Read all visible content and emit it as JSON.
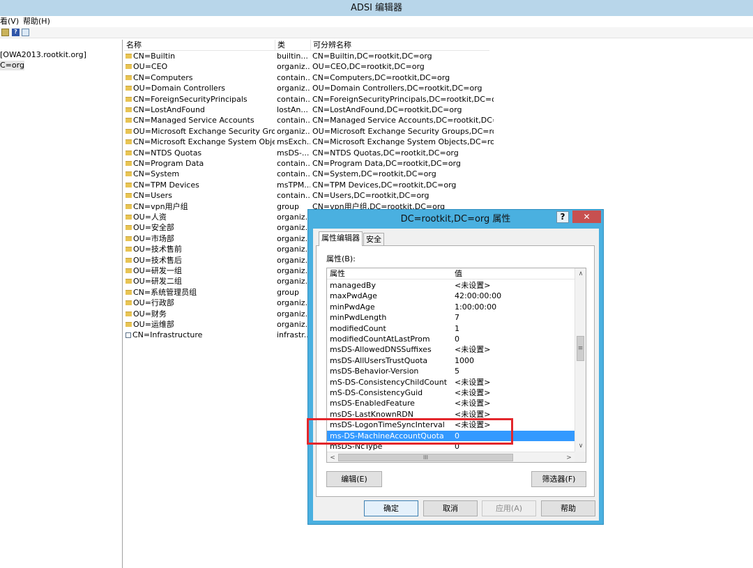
{
  "window": {
    "title": "ADSI 编辑器"
  },
  "menu": [
    "看(V)",
    "帮助(H)"
  ],
  "toolbar": {
    "icons": [
      "up-folder-icon",
      "help-icon",
      "show-hide-console-tree-icon"
    ]
  },
  "tree": [
    {
      "label": "[OWA2013.rootkit.org]",
      "selected": false
    },
    {
      "label": "C=org",
      "selected": true
    }
  ],
  "list": {
    "headers": {
      "name": "名称",
      "class": "类",
      "dn": "可分辨名称"
    },
    "rows": [
      {
        "icon": "folder",
        "name": "CN=Builtin",
        "class": "builtin...",
        "dn": "CN=Builtin,DC=rootkit,DC=org"
      },
      {
        "icon": "folder",
        "name": "OU=CEO",
        "class": "organiz...",
        "dn": "OU=CEO,DC=rootkit,DC=org"
      },
      {
        "icon": "folder",
        "name": "CN=Computers",
        "class": "contain...",
        "dn": "CN=Computers,DC=rootkit,DC=org"
      },
      {
        "icon": "folder",
        "name": "OU=Domain Controllers",
        "class": "organiz...",
        "dn": "OU=Domain Controllers,DC=rootkit,DC=org"
      },
      {
        "icon": "folder",
        "name": "CN=ForeignSecurityPrincipals",
        "class": "contain...",
        "dn": "CN=ForeignSecurityPrincipals,DC=rootkit,DC=org"
      },
      {
        "icon": "folder",
        "name": "CN=LostAndFound",
        "class": "lostAn...",
        "dn": "CN=LostAndFound,DC=rootkit,DC=org"
      },
      {
        "icon": "folder",
        "name": "CN=Managed Service Accounts",
        "class": "contain...",
        "dn": "CN=Managed Service Accounts,DC=rootkit,DC=..."
      },
      {
        "icon": "folder",
        "name": "OU=Microsoft Exchange Security Groups",
        "class": "organiz...",
        "dn": "OU=Microsoft Exchange Security Groups,DC=roo..."
      },
      {
        "icon": "folder",
        "name": "CN=Microsoft Exchange System Objects",
        "class": "msExch...",
        "dn": "CN=Microsoft Exchange System Objects,DC=root..."
      },
      {
        "icon": "folder",
        "name": "CN=NTDS Quotas",
        "class": "msDS-...",
        "dn": "CN=NTDS Quotas,DC=rootkit,DC=org"
      },
      {
        "icon": "folder",
        "name": "CN=Program Data",
        "class": "contain...",
        "dn": "CN=Program Data,DC=rootkit,DC=org"
      },
      {
        "icon": "folder",
        "name": "CN=System",
        "class": "contain...",
        "dn": "CN=System,DC=rootkit,DC=org"
      },
      {
        "icon": "folder",
        "name": "CN=TPM Devices",
        "class": "msTPM...",
        "dn": "CN=TPM Devices,DC=rootkit,DC=org"
      },
      {
        "icon": "folder",
        "name": "CN=Users",
        "class": "contain...",
        "dn": "CN=Users,DC=rootkit,DC=org"
      },
      {
        "icon": "folder",
        "name": "CN=vpn用户组",
        "class": "group",
        "dn": "CN=vpn用户组,DC=rootkit,DC=org"
      },
      {
        "icon": "folder",
        "name": "OU=人资",
        "class": "organiz...",
        "dn": ""
      },
      {
        "icon": "folder",
        "name": "OU=安全部",
        "class": "organiz...",
        "dn": ""
      },
      {
        "icon": "folder",
        "name": "OU=市场部",
        "class": "organiz...",
        "dn": ""
      },
      {
        "icon": "folder",
        "name": "OU=技术售前",
        "class": "organiz...",
        "dn": ""
      },
      {
        "icon": "folder",
        "name": "OU=技术售后",
        "class": "organiz...",
        "dn": ""
      },
      {
        "icon": "folder",
        "name": "OU=研发一组",
        "class": "organiz...",
        "dn": ""
      },
      {
        "icon": "folder",
        "name": "OU=研发二组",
        "class": "organiz...",
        "dn": ""
      },
      {
        "icon": "folder",
        "name": "CN=系统管理员组",
        "class": "group",
        "dn": ""
      },
      {
        "icon": "folder",
        "name": "OU=行政部",
        "class": "organiz...",
        "dn": ""
      },
      {
        "icon": "folder",
        "name": "OU=财务",
        "class": "organiz...",
        "dn": ""
      },
      {
        "icon": "folder",
        "name": "OU=运维部",
        "class": "organiz...",
        "dn": ""
      },
      {
        "icon": "container",
        "name": "CN=Infrastructure",
        "class": "infrastr...",
        "dn": ""
      }
    ]
  },
  "dialog": {
    "title": "DC=rootkit,DC=org 属性",
    "help_glyph": "?",
    "close_glyph": "✕",
    "tabs": [
      "属性编辑器",
      "安全"
    ],
    "active_tab": 0,
    "attributes_label": "属性(B):",
    "columns": {
      "attr": "属性",
      "value": "值"
    },
    "attributes": [
      {
        "name": "managedBy",
        "value": "<未设置>"
      },
      {
        "name": "maxPwdAge",
        "value": "42:00:00:00"
      },
      {
        "name": "minPwdAge",
        "value": "1:00:00:00"
      },
      {
        "name": "minPwdLength",
        "value": "7"
      },
      {
        "name": "modifiedCount",
        "value": "1"
      },
      {
        "name": "modifiedCountAtLastProm",
        "value": "0"
      },
      {
        "name": "msDS-AllowedDNSSuffixes",
        "value": "<未设置>"
      },
      {
        "name": "msDS-AllUsersTrustQuota",
        "value": "1000"
      },
      {
        "name": "msDS-Behavior-Version",
        "value": "5"
      },
      {
        "name": "mS-DS-ConsistencyChildCount",
        "value": "<未设置>"
      },
      {
        "name": "mS-DS-ConsistencyGuid",
        "value": "<未设置>"
      },
      {
        "name": "msDS-EnabledFeature",
        "value": "<未设置>"
      },
      {
        "name": "msDS-LastKnownRDN",
        "value": "<未设置>"
      },
      {
        "name": "msDS-LogonTimeSyncInterval",
        "value": "<未设置>"
      },
      {
        "name": "ms-DS-MachineAccountQuota",
        "value": "0",
        "selected": true
      },
      {
        "name": "msDS-NcType",
        "value": "0"
      }
    ],
    "scroll_thumb_glyph": "≡",
    "hscroll_thumb_glyph": "III",
    "edit_button": "编辑(E)",
    "filter_button": "筛选器(F)",
    "ok_button": "确定",
    "cancel_button": "取消",
    "apply_button": "应用(A)",
    "help_button": "帮助",
    "highlight_color": "#e3262b",
    "selection_color": "#3399ff"
  }
}
